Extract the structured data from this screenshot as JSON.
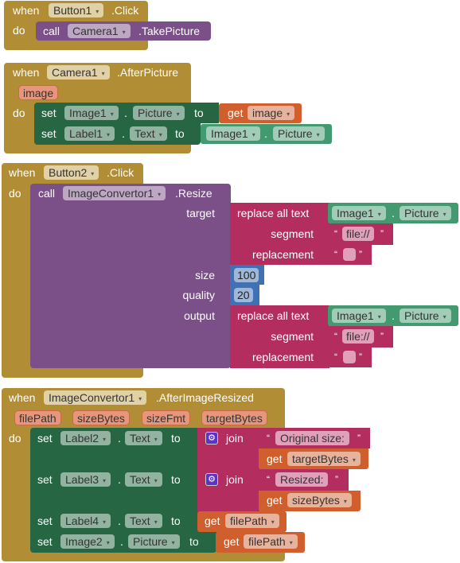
{
  "common": {
    "when": "when",
    "do": "do",
    "call": "call",
    "set": "set",
    "to": "to",
    "get": "get",
    "dot": ".",
    "join": "join",
    "open_quote": "“",
    "close_quote": "”",
    "dropdown_icon": "▾",
    "gear_icon": "⚙"
  },
  "block1": {
    "component": "Button1",
    "event": ".Click",
    "call_component": "Camera1",
    "method": ".TakePicture"
  },
  "block2": {
    "component": "Camera1",
    "event": ".AfterPicture",
    "params": [
      "image"
    ],
    "stmt1": {
      "component": "Image1",
      "property": "Picture",
      "get_var": "image"
    },
    "stmt2": {
      "component": "Label1",
      "property": "Text",
      "value_component": "Image1",
      "value_property": "Picture"
    }
  },
  "block3": {
    "component": "Button2",
    "event": ".Click",
    "call_component": "ImageConvertor1",
    "method": ".Resize",
    "args": {
      "target_label": "target",
      "size_label": "size",
      "quality_label": "quality",
      "output_label": "output",
      "size_value": "100",
      "quality_value": "20"
    },
    "replace": {
      "label": "replace all text",
      "segment_label": "segment",
      "replacement_label": "replacement",
      "component": "Image1",
      "property": "Picture",
      "segment_value": "file://",
      "replacement_value": ""
    }
  },
  "block4": {
    "component": "ImageConvertor1",
    "event": ".AfterImageResized",
    "params": [
      "filePath",
      "sizeBytes",
      "sizeFmt",
      "targetBytes"
    ],
    "stmt1": {
      "component": "Label2",
      "property": "Text",
      "text": "Original size:",
      "get_var": "targetBytes"
    },
    "stmt2": {
      "component": "Label3",
      "property": "Text",
      "text": "Resized:",
      "get_var": "sizeBytes"
    },
    "stmt3": {
      "component": "Label4",
      "property": "Text",
      "get_var": "filePath"
    },
    "stmt4": {
      "component": "Image2",
      "property": "Picture",
      "get_var": "filePath"
    }
  },
  "colors": {
    "event": "#b18e35",
    "procedure_call": "#7b4f87",
    "setter": "#266643",
    "component_getter": "#439970",
    "text": "#b32d5e",
    "variable_get": "#d05f2d",
    "number": "#3f71b5",
    "mutator": "#5b33c8"
  }
}
